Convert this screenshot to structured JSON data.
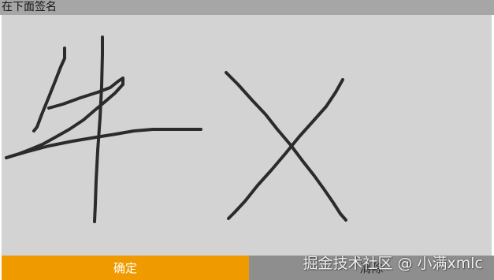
{
  "header": {
    "prompt": "在下面签名"
  },
  "signature_pad": {
    "strokes_drawn": true,
    "ink_color": "#2b2b2b",
    "background_color": "#d3d3d3"
  },
  "actions": {
    "confirm_label": "确定",
    "clear_label": "清除"
  },
  "watermark": {
    "text": "掘金技术社区 @ 小满xmlc"
  },
  "colors": {
    "topbar": "#a6a6a6",
    "confirm": "#ef9b00",
    "clear": "#8e8e8e"
  }
}
